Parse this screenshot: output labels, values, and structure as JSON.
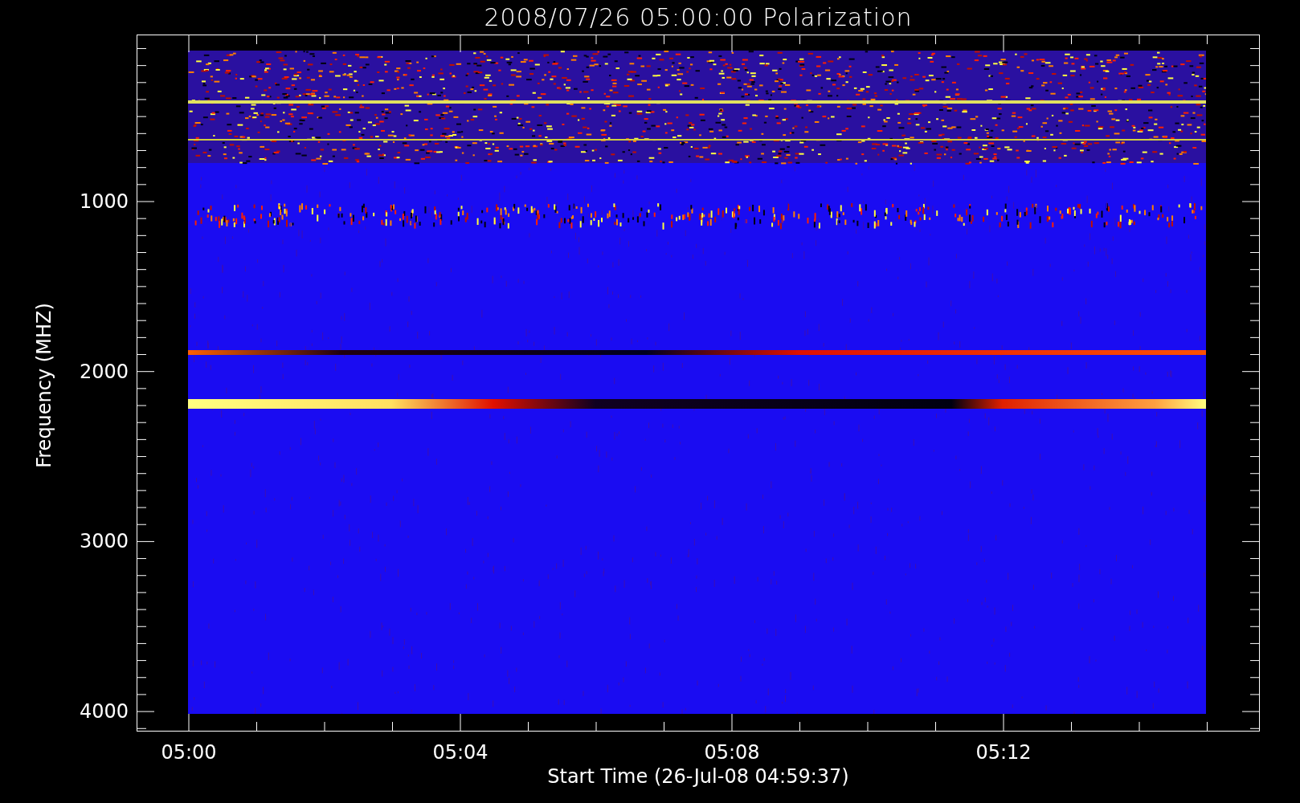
{
  "title": "2008/07/26 05:00:00 Polarization",
  "y_axis": {
    "label": "Frequency (MHZ)",
    "ticks": [
      "1000",
      "2000",
      "3000",
      "4000"
    ]
  },
  "x_axis": {
    "label": "Start Time (26-Jul-08 04:59:37)",
    "ticks": [
      "05:00",
      "05:04",
      "05:08",
      "05:12"
    ]
  }
}
